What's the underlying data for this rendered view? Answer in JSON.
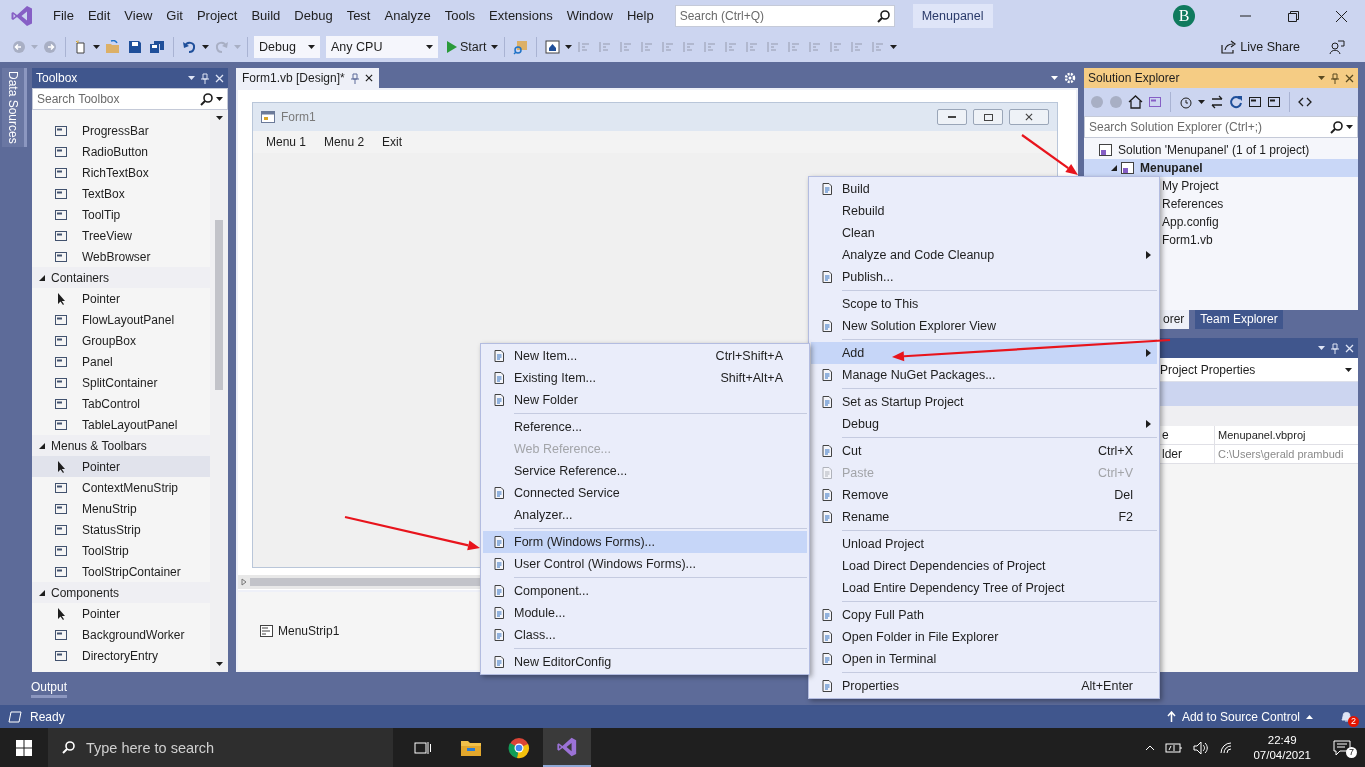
{
  "title_bar": {
    "menu": [
      "File",
      "Edit",
      "View",
      "Git",
      "Project",
      "Build",
      "Debug",
      "Test",
      "Analyze",
      "Tools",
      "Extensions",
      "Window",
      "Help"
    ],
    "search": {
      "placeholder": "Search (Ctrl+Q)"
    },
    "solution": "Menupanel",
    "avatar": "B"
  },
  "toolbar": {
    "configuration": "Debug",
    "platform": "Any CPU",
    "start": "Start",
    "live_share": "Live Share"
  },
  "side_tabs": [
    "Data Sources"
  ],
  "toolbox": {
    "title": "Toolbox",
    "search": {
      "placeholder": "Search Toolbox"
    },
    "tools": [
      {
        "label": "ProgressBar",
        "kind": "control",
        "selected": false
      },
      {
        "label": "RadioButton",
        "kind": "control",
        "selected": false
      },
      {
        "label": "RichTextBox",
        "kind": "control",
        "selected": false
      },
      {
        "label": "TextBox",
        "kind": "control",
        "selected": false
      },
      {
        "label": "ToolTip",
        "kind": "control",
        "selected": false
      },
      {
        "label": "TreeView",
        "kind": "control",
        "selected": false
      },
      {
        "label": "WebBrowser",
        "kind": "control",
        "selected": false
      }
    ],
    "groups": [
      {
        "name": "Containers",
        "expanded": true,
        "children": [
          {
            "label": "Pointer",
            "kind": "pointer",
            "selected": false
          },
          {
            "label": "FlowLayoutPanel",
            "kind": "control",
            "selected": false
          },
          {
            "label": "GroupBox",
            "kind": "control",
            "selected": false
          },
          {
            "label": "Panel",
            "kind": "control",
            "selected": false
          },
          {
            "label": "SplitContainer",
            "kind": "control",
            "selected": false
          },
          {
            "label": "TabControl",
            "kind": "control",
            "selected": false
          },
          {
            "label": "TableLayoutPanel",
            "kind": "control",
            "selected": false
          }
        ]
      },
      {
        "name": "Menus & Toolbars",
        "expanded": true,
        "children": [
          {
            "label": "Pointer",
            "kind": "pointer",
            "selected": true
          },
          {
            "label": "ContextMenuStrip",
            "kind": "control",
            "selected": false
          },
          {
            "label": "MenuStrip",
            "kind": "control",
            "selected": false
          },
          {
            "label": "StatusStrip",
            "kind": "control",
            "selected": false
          },
          {
            "label": "ToolStrip",
            "kind": "control",
            "selected": false
          },
          {
            "label": "ToolStripContainer",
            "kind": "control",
            "selected": false
          }
        ]
      },
      {
        "name": "Components",
        "expanded": true,
        "children": [
          {
            "label": "Pointer",
            "kind": "pointer",
            "selected": false
          },
          {
            "label": "BackgroundWorker",
            "kind": "control",
            "selected": false
          },
          {
            "label": "DirectoryEntry",
            "kind": "control",
            "selected": false
          }
        ]
      }
    ]
  },
  "document": {
    "tab": {
      "title": "Form1.vb [Design]*",
      "selected": true
    },
    "form": {
      "title": "Form1",
      "menu": [
        "Menu 1",
        "Menu 2",
        "Exit"
      ]
    },
    "tray": [
      "MenuStrip1"
    ]
  },
  "solution_explorer": {
    "title": "Solution Explorer",
    "search": {
      "placeholder": "Search Solution Explorer (Ctrl+;)"
    },
    "tree": [
      {
        "label": "Solution 'Menupanel' (1 of 1 project)",
        "selected": false,
        "children": [
          {
            "label": "Menupanel",
            "selected": true,
            "expanded": true,
            "children": [
              {
                "label": "My Project",
                "selected": false
              },
              {
                "label": "References",
                "selected": false
              },
              {
                "label": "App.config",
                "selected": false
              },
              {
                "label": "Form1.vb",
                "selected": false
              }
            ]
          }
        ]
      }
    ],
    "tabs": [
      {
        "label": "orer",
        "selected": true
      },
      {
        "label": "Team Explorer",
        "selected": false
      }
    ]
  },
  "properties": {
    "object": "Project Properties",
    "rows": [
      {
        "name": "e",
        "value": "Menupanel.vbproj",
        "disabled": false
      },
      {
        "name": "lder",
        "value": "C:\\Users\\gerald prambudi",
        "disabled": true
      }
    ]
  },
  "context_menu": {
    "items": [
      {
        "kind": "item",
        "label": "Build",
        "icon": true,
        "submenu": false,
        "disabled": false,
        "selected": false
      },
      {
        "kind": "item",
        "label": "Rebuild",
        "icon": false,
        "submenu": false,
        "disabled": false,
        "selected": false
      },
      {
        "kind": "item",
        "label": "Clean",
        "icon": false,
        "submenu": false,
        "disabled": false,
        "selected": false
      },
      {
        "kind": "item",
        "label": "Analyze and Code Cleanup",
        "icon": false,
        "submenu": true,
        "disabled": false,
        "selected": false
      },
      {
        "kind": "item",
        "label": "Publish...",
        "icon": true,
        "submenu": false,
        "disabled": false,
        "selected": false
      },
      {
        "kind": "separator"
      },
      {
        "kind": "item",
        "label": "Scope to This",
        "icon": false,
        "submenu": false,
        "disabled": false,
        "selected": false
      },
      {
        "kind": "item",
        "label": "New Solution Explorer View",
        "icon": true,
        "submenu": false,
        "disabled": false,
        "selected": false
      },
      {
        "kind": "separator"
      },
      {
        "kind": "item",
        "label": "Add",
        "icon": false,
        "submenu": true,
        "disabled": false,
        "selected": true
      },
      {
        "kind": "item",
        "label": "Manage NuGet Packages...",
        "icon": true,
        "submenu": false,
        "disabled": false,
        "selected": false
      },
      {
        "kind": "separator"
      },
      {
        "kind": "item",
        "label": "Set as Startup Project",
        "icon": true,
        "submenu": false,
        "disabled": false,
        "selected": false
      },
      {
        "kind": "item",
        "label": "Debug",
        "icon": false,
        "submenu": true,
        "disabled": false,
        "selected": false
      },
      {
        "kind": "separator"
      },
      {
        "kind": "item",
        "label": "Cut",
        "shortcut": "Ctrl+X",
        "icon": true,
        "submenu": false,
        "disabled": false,
        "selected": false
      },
      {
        "kind": "item",
        "label": "Paste",
        "shortcut": "Ctrl+V",
        "icon": true,
        "submenu": false,
        "disabled": true,
        "selected": false
      },
      {
        "kind": "item",
        "label": "Remove",
        "shortcut": "Del",
        "icon": true,
        "submenu": false,
        "disabled": false,
        "selected": false
      },
      {
        "kind": "item",
        "label": "Rename",
        "shortcut": "F2",
        "icon": true,
        "submenu": false,
        "disabled": false,
        "selected": false
      },
      {
        "kind": "separator"
      },
      {
        "kind": "item",
        "label": "Unload Project",
        "icon": false,
        "submenu": false,
        "disabled": false,
        "selected": false
      },
      {
        "kind": "item",
        "label": "Load Direct Dependencies of Project",
        "icon": false,
        "submenu": false,
        "disabled": false,
        "selected": false
      },
      {
        "kind": "item",
        "label": "Load Entire Dependency Tree of Project",
        "icon": false,
        "submenu": false,
        "disabled": false,
        "selected": false
      },
      {
        "kind": "separator"
      },
      {
        "kind": "item",
        "label": "Copy Full Path",
        "icon": true,
        "submenu": false,
        "disabled": false,
        "selected": false
      },
      {
        "kind": "item",
        "label": "Open Folder in File Explorer",
        "icon": true,
        "submenu": false,
        "disabled": false,
        "selected": false
      },
      {
        "kind": "item",
        "label": "Open in Terminal",
        "icon": true,
        "submenu": false,
        "disabled": false,
        "selected": false
      },
      {
        "kind": "separator"
      },
      {
        "kind": "item",
        "label": "Properties",
        "shortcut": "Alt+Enter",
        "icon": true,
        "submenu": false,
        "disabled": false,
        "selected": false
      }
    ]
  },
  "add_submenu": {
    "items": [
      {
        "kind": "item",
        "label": "New Item...",
        "shortcut": "Ctrl+Shift+A",
        "icon": true,
        "submenu": false,
        "disabled": false,
        "selected": false
      },
      {
        "kind": "item",
        "label": "Existing Item...",
        "shortcut": "Shift+Alt+A",
        "icon": true,
        "submenu": false,
        "disabled": false,
        "selected": false
      },
      {
        "kind": "item",
        "label": "New Folder",
        "icon": true,
        "submenu": false,
        "disabled": false,
        "selected": false
      },
      {
        "kind": "separator"
      },
      {
        "kind": "item",
        "label": "Reference...",
        "icon": false,
        "submenu": false,
        "disabled": false,
        "selected": false
      },
      {
        "kind": "item",
        "label": "Web Reference...",
        "icon": false,
        "submenu": false,
        "disabled": true,
        "selected": false
      },
      {
        "kind": "item",
        "label": "Service Reference...",
        "icon": false,
        "submenu": false,
        "disabled": false,
        "selected": false
      },
      {
        "kind": "item",
        "label": "Connected Service",
        "icon": true,
        "submenu": false,
        "disabled": false,
        "selected": false
      },
      {
        "kind": "item",
        "label": "Analyzer...",
        "icon": false,
        "submenu": false,
        "disabled": false,
        "selected": false
      },
      {
        "kind": "separator"
      },
      {
        "kind": "item",
        "label": "Form (Windows Forms)...",
        "icon": true,
        "submenu": false,
        "disabled": false,
        "selected": true
      },
      {
        "kind": "item",
        "label": "User Control (Windows Forms)...",
        "icon": true,
        "submenu": false,
        "disabled": false,
        "selected": false
      },
      {
        "kind": "separator"
      },
      {
        "kind": "item",
        "label": "Component...",
        "icon": true,
        "submenu": false,
        "disabled": false,
        "selected": false
      },
      {
        "kind": "item",
        "label": "Module...",
        "icon": true,
        "submenu": false,
        "disabled": false,
        "selected": false
      },
      {
        "kind": "item",
        "label": "Class...",
        "icon": true,
        "submenu": false,
        "disabled": false,
        "selected": false
      },
      {
        "kind": "separator"
      },
      {
        "kind": "item",
        "label": "New EditorConfig",
        "icon": true,
        "submenu": false,
        "disabled": false,
        "selected": false
      }
    ]
  },
  "bottom_tabs": [
    "Output"
  ],
  "status_bar": {
    "status": "Ready",
    "source_control": "Add to Source Control",
    "notifications": "2"
  },
  "taskbar": {
    "search": {
      "placeholder": "Type here to search"
    },
    "time": "22:49",
    "date": "07/04/2021",
    "notifications": "7"
  }
}
